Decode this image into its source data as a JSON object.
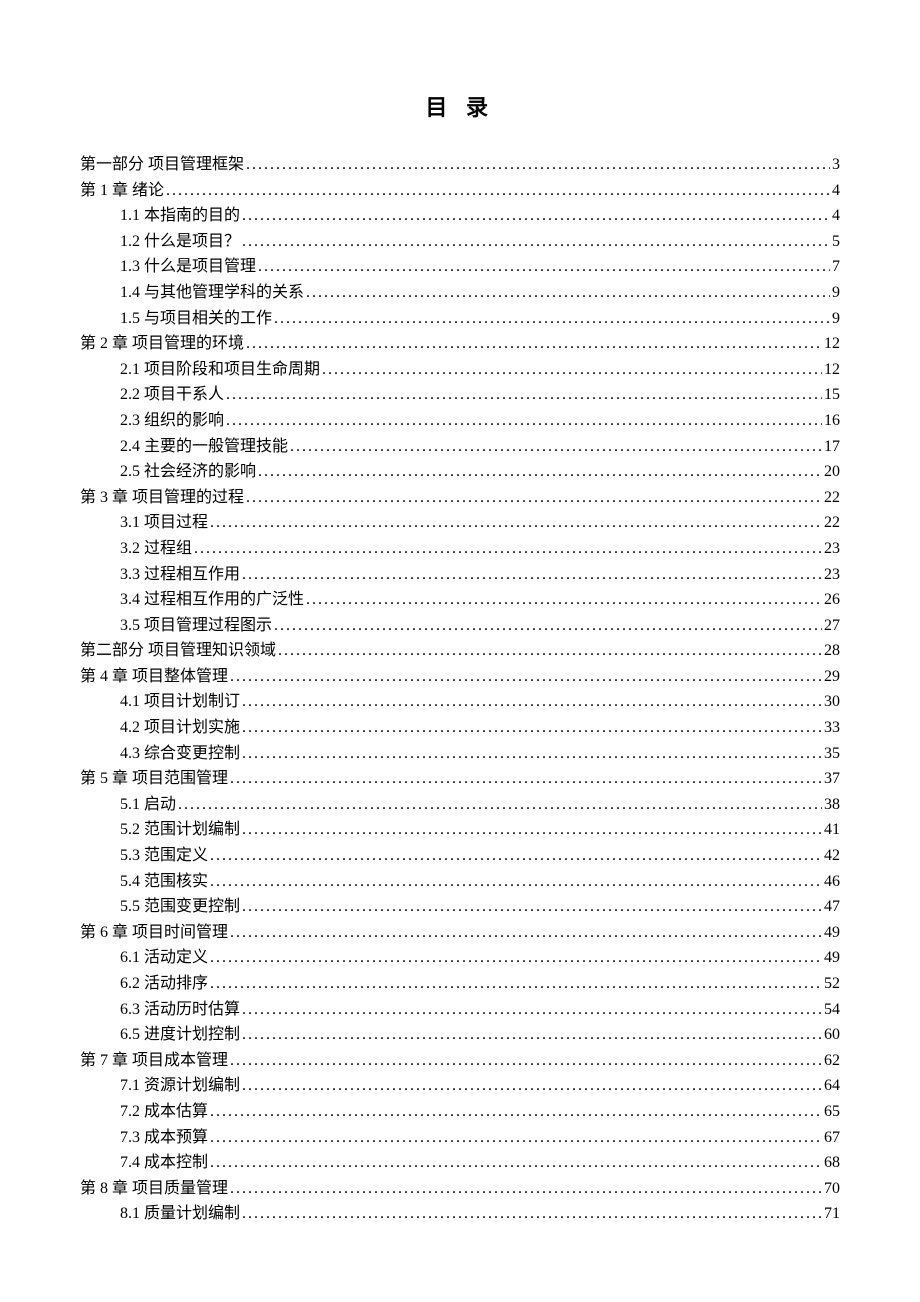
{
  "title": "目 录",
  "entries": [
    {
      "level": 1,
      "label": "第一部分 项目管理框架",
      "page": "3"
    },
    {
      "level": 1,
      "label": "第 1 章 绪论",
      "page": "4"
    },
    {
      "level": 2,
      "label": "1.1 本指南的目的",
      "page": "4"
    },
    {
      "level": 2,
      "label": "1.2 什么是项目？",
      "page": "5"
    },
    {
      "level": 2,
      "label": "1.3 什么是项目管理",
      "page": "7"
    },
    {
      "level": 2,
      "label": "1.4 与其他管理学科的关系",
      "page": "9"
    },
    {
      "level": 2,
      "label": "1.5 与项目相关的工作",
      "page": "9"
    },
    {
      "level": 1,
      "label": "第 2 章 项目管理的环境",
      "page": "12"
    },
    {
      "level": 2,
      "label": "2.1 项目阶段和项目生命周期",
      "page": "12"
    },
    {
      "level": 2,
      "label": "2.2 项目干系人",
      "page": "15"
    },
    {
      "level": 2,
      "label": "2.3 组织的影响",
      "page": "16"
    },
    {
      "level": 2,
      "label": "2.4 主要的一般管理技能",
      "page": "17"
    },
    {
      "level": 2,
      "label": "2.5 社会经济的影响",
      "page": "20"
    },
    {
      "level": 1,
      "label": "第 3 章 项目管理的过程",
      "page": "22"
    },
    {
      "level": 2,
      "label": "3.1 项目过程",
      "page": "22"
    },
    {
      "level": 2,
      "label": "3.2 过程组",
      "page": "23"
    },
    {
      "level": 2,
      "label": "3.3 过程相互作用",
      "page": "23"
    },
    {
      "level": 2,
      "label": "3.4 过程相互作用的广泛性",
      "page": "26"
    },
    {
      "level": 2,
      "label": "3.5 项目管理过程图示",
      "page": "27"
    },
    {
      "level": 1,
      "label": "第二部分 项目管理知识领域",
      "page": "28"
    },
    {
      "level": 1,
      "label": "第 4 章 项目整体管理",
      "page": "29"
    },
    {
      "level": 2,
      "label": "4.1 项目计划制订",
      "page": "30"
    },
    {
      "level": 2,
      "label": "4.2 项目计划实施",
      "page": "33"
    },
    {
      "level": 2,
      "label": "4.3 综合变更控制",
      "page": "35"
    },
    {
      "level": 1,
      "label": "第 5 章 项目范围管理",
      "page": "37"
    },
    {
      "level": 2,
      "label": "5.1 启动",
      "page": "38"
    },
    {
      "level": 2,
      "label": "5.2 范围计划编制",
      "page": "41"
    },
    {
      "level": 2,
      "label": "5.3 范围定义",
      "page": "42"
    },
    {
      "level": 2,
      "label": "5.4 范围核实",
      "page": "46"
    },
    {
      "level": 2,
      "label": "5.5 范围变更控制",
      "page": "47"
    },
    {
      "level": 1,
      "label": "第 6 章 项目时间管理",
      "page": "49"
    },
    {
      "level": 2,
      "label": "6.1 活动定义",
      "page": "49"
    },
    {
      "level": 2,
      "label": "6.2 活动排序",
      "page": "52"
    },
    {
      "level": 2,
      "label": "6.3 活动历时估算",
      "page": "54"
    },
    {
      "level": 2,
      "label": "6.5 进度计划控制",
      "page": "60"
    },
    {
      "level": 1,
      "label": "第 7 章 项目成本管理",
      "page": "62"
    },
    {
      "level": 2,
      "label": "7.1 资源计划编制",
      "page": "64"
    },
    {
      "level": 2,
      "label": "7.2 成本估算",
      "page": "65"
    },
    {
      "level": 2,
      "label": "7.3 成本预算",
      "page": "67"
    },
    {
      "level": 2,
      "label": "7.4 成本控制",
      "page": "68"
    },
    {
      "level": 1,
      "label": "第 8 章 项目质量管理",
      "page": "70"
    },
    {
      "level": 2,
      "label": "8.1 质量计划编制",
      "page": "71"
    }
  ]
}
